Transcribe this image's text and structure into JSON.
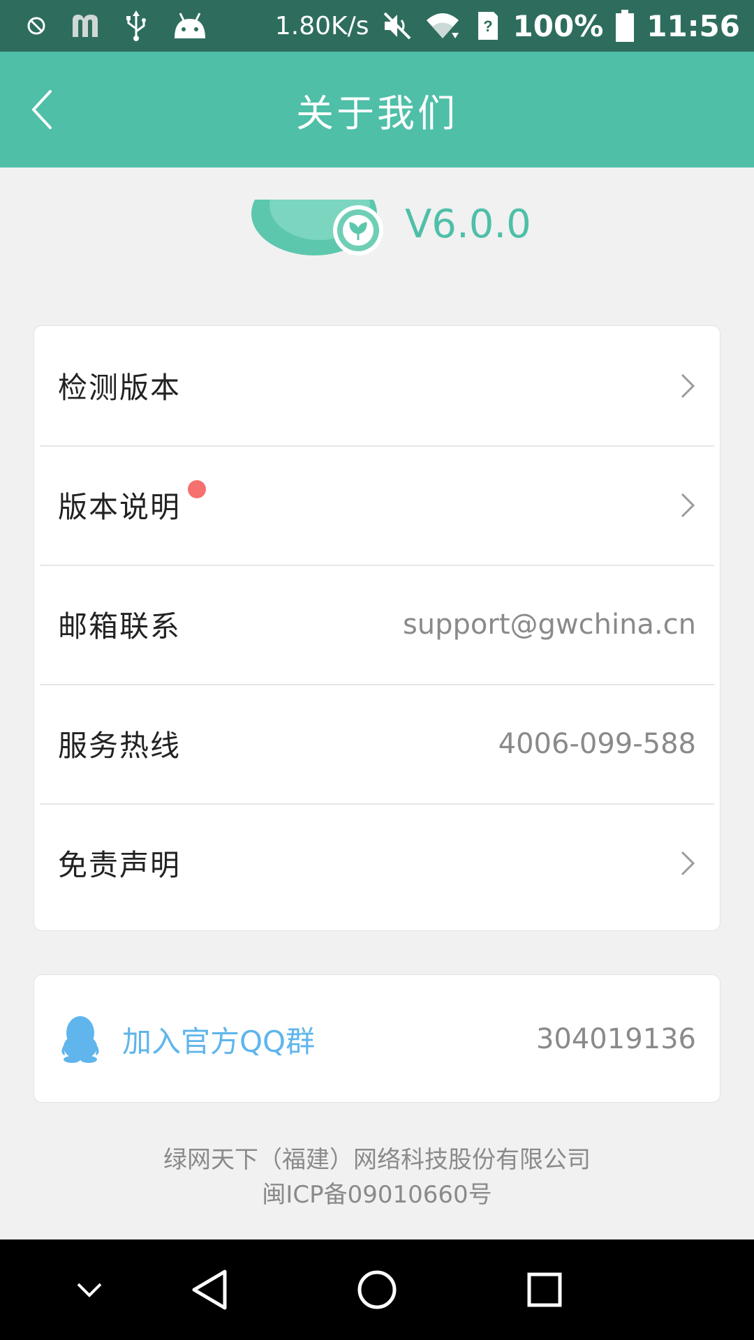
{
  "status_bar": {
    "net_speed": "1.80K/s",
    "battery": "100%",
    "time": "11:56"
  },
  "header": {
    "title": "关于我们"
  },
  "app_info": {
    "version": "V6.0.0"
  },
  "menu": {
    "items": [
      {
        "label": "检测版本",
        "value": "",
        "has_chevron": true,
        "has_badge": false
      },
      {
        "label": "版本说明",
        "value": "",
        "has_chevron": true,
        "has_badge": true
      },
      {
        "label": "邮箱联系",
        "value": "support@gwchina.cn",
        "has_chevron": false,
        "has_badge": false
      },
      {
        "label": "服务热线",
        "value": "4006-099-588",
        "has_chevron": false,
        "has_badge": false
      },
      {
        "label": "免责声明",
        "value": "",
        "has_chevron": true,
        "has_badge": false
      }
    ]
  },
  "qq_group": {
    "label": "加入官方QQ群",
    "number": "304019136"
  },
  "footer": {
    "company": "绿网天下（福建）网络科技股份有限公司",
    "icp": "闽ICP备09010660号"
  },
  "colors": {
    "accent": "#4fbfa8",
    "status_bar": "#2e6d5e",
    "qq_blue": "#5fb5ec",
    "badge_red": "#f5706f"
  },
  "icons": [
    "back-arrow-icon",
    "chevron-right-icon",
    "qq-penguin-icon",
    "wifi-icon",
    "battery-icon",
    "mute-icon",
    "usb-icon",
    "android-icon",
    "dnd-icon",
    "sim-icon",
    "nav-collapse-icon",
    "nav-back-icon",
    "nav-home-icon",
    "nav-recents-icon"
  ]
}
